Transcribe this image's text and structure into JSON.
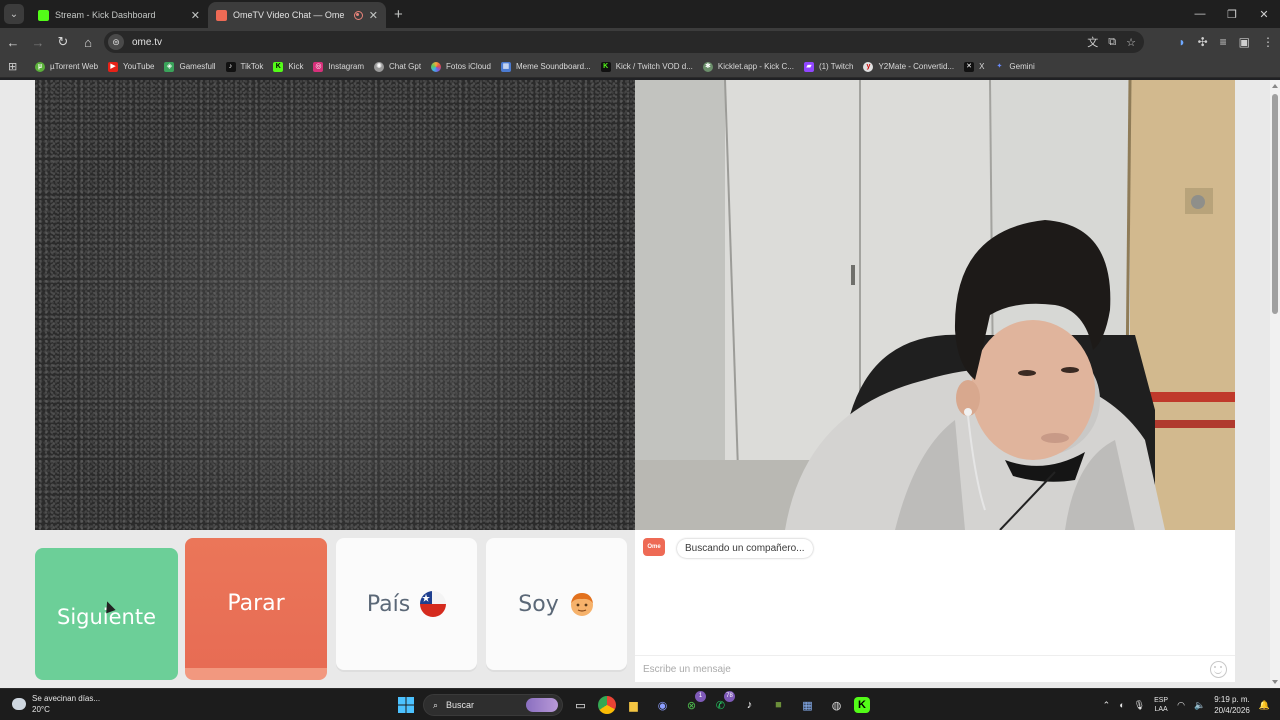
{
  "tabs": [
    {
      "title": "Stream - Kick Dashboard",
      "favicon_color": "#53fc18",
      "active": false
    },
    {
      "title": "OmeTV Video Chat — Ome",
      "favicon_color": "#ee6a55",
      "active": true
    }
  ],
  "address": {
    "url": "ome.tv"
  },
  "bookmarks": [
    {
      "label": "µTorrent Web",
      "color": "#5bb13a"
    },
    {
      "label": "YouTube",
      "color": "#e62117"
    },
    {
      "label": "Gamesfull",
      "color": "#3aa35a"
    },
    {
      "label": "TikTok",
      "color": "#111111"
    },
    {
      "label": "Kick",
      "color": "#53fc18"
    },
    {
      "label": "Instagram",
      "color": "#d6307a"
    },
    {
      "label": "Chat Gpt",
      "color": "#9a9a9a"
    },
    {
      "label": "Fotos iCloud",
      "color": "#f2a93b"
    },
    {
      "label": "Meme Soundboard...",
      "color": "#4b7bd1"
    },
    {
      "label": "Kick / Twitch VOD d...",
      "color": "#111111"
    },
    {
      "label": "Kicklet.app - Kick C...",
      "color": "#6b8f6b"
    },
    {
      "label": "(1) Twitch",
      "color": "#9146ff"
    },
    {
      "label": "Y2Mate - Convertid...",
      "color": "#e0e0e0"
    },
    {
      "label": "X",
      "color": "#111111"
    },
    {
      "label": "Gemini",
      "color": "#6a8cff"
    }
  ],
  "main": {
    "buttons": {
      "next": "Siguiente",
      "stop": "Parar",
      "country": "País",
      "soy": "Soy"
    },
    "chat": {
      "logo_text": "Ome TV",
      "status": "Buscando un compañero...",
      "input_placeholder": "Escribe un mensaje"
    }
  },
  "taskbar": {
    "weather_line1": "Se avecinan días...",
    "weather_line2": "20°C",
    "search_label": "Buscar",
    "badge_1": "1",
    "badge_78": "78",
    "lang_line1": "ESP",
    "lang_line2": "LAA",
    "time": "9:19 p. m.",
    "date": "20/4/2026"
  },
  "colors": {
    "next_button": "#6ccf98",
    "stop_button": "#e76c54",
    "brand": "#ee6a55"
  }
}
